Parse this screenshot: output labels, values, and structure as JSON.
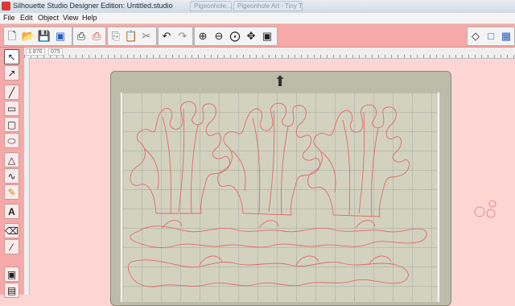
{
  "window": {
    "title": "Silhouette Studio Designer Edition: Untitled.studio",
    "bg_tabs": [
      "Pigeonhole...",
      "Pigeonhole Art - Tiny Treats Valentine..."
    ]
  },
  "menu": [
    "File",
    "Edit",
    "Object",
    "View",
    "Help"
  ],
  "ruler": {
    "coord_x": "1.870",
    "coord_y": "075"
  },
  "colors": {
    "toolbar": "#f6a9a8",
    "canvas": "#fdd6d4",
    "mat": "#bdbba9",
    "cut_line": "#e06a6a"
  }
}
